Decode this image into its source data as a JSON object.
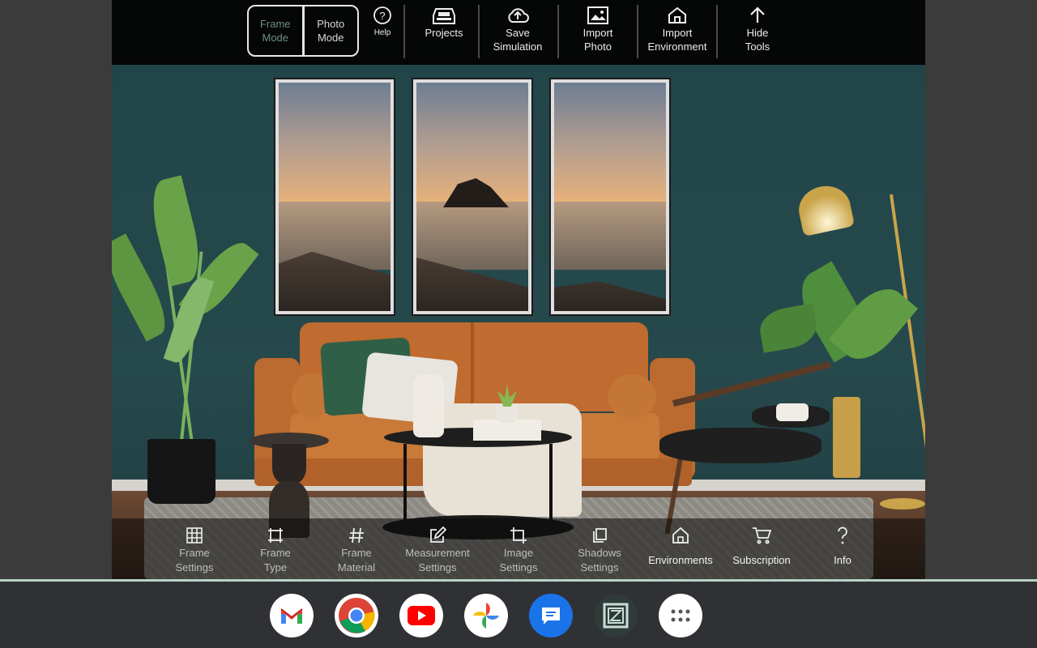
{
  "toolbar": {
    "modes": [
      {
        "label": "Frame\nMode",
        "active": true
      },
      {
        "label": "Photo\nMode",
        "active": false
      }
    ],
    "help_label": "Help",
    "items": [
      {
        "label": "Projects",
        "icon": "projects-icon"
      },
      {
        "label": "Save\nSimulation",
        "icon": "cloud-upload-icon"
      },
      {
        "label": "Import\nPhoto",
        "icon": "image-icon"
      },
      {
        "label": "Import\nEnvironment",
        "icon": "home-icon"
      },
      {
        "label": "Hide\nTools",
        "icon": "arrow-up-icon"
      }
    ]
  },
  "bottom_toolbar": {
    "items": [
      {
        "label": "Frame\nSettings",
        "icon": "grid-icon"
      },
      {
        "label": "Frame\nType",
        "icon": "frame-crop-icon"
      },
      {
        "label": "Frame\nMaterial",
        "icon": "hash-icon"
      },
      {
        "label": "Measurement\nSettings",
        "icon": "edit-icon"
      },
      {
        "label": "Image\nSettings",
        "icon": "crop-icon"
      },
      {
        "label": "Shadows\nSettings",
        "icon": "copy-icon"
      },
      {
        "label": "Environments",
        "icon": "home-icon"
      },
      {
        "label": "Subscription",
        "icon": "cart-icon"
      },
      {
        "label": "Info",
        "icon": "question-icon"
      }
    ]
  },
  "shelf": {
    "apps": [
      "gmail-icon",
      "chrome-icon",
      "youtube-icon",
      "photos-icon",
      "messages-icon",
      "frame-app-icon",
      "launcher-icon"
    ]
  },
  "colors": {
    "wall": "#214548",
    "accent": "#6d8f84",
    "toolbar": "#050606"
  }
}
